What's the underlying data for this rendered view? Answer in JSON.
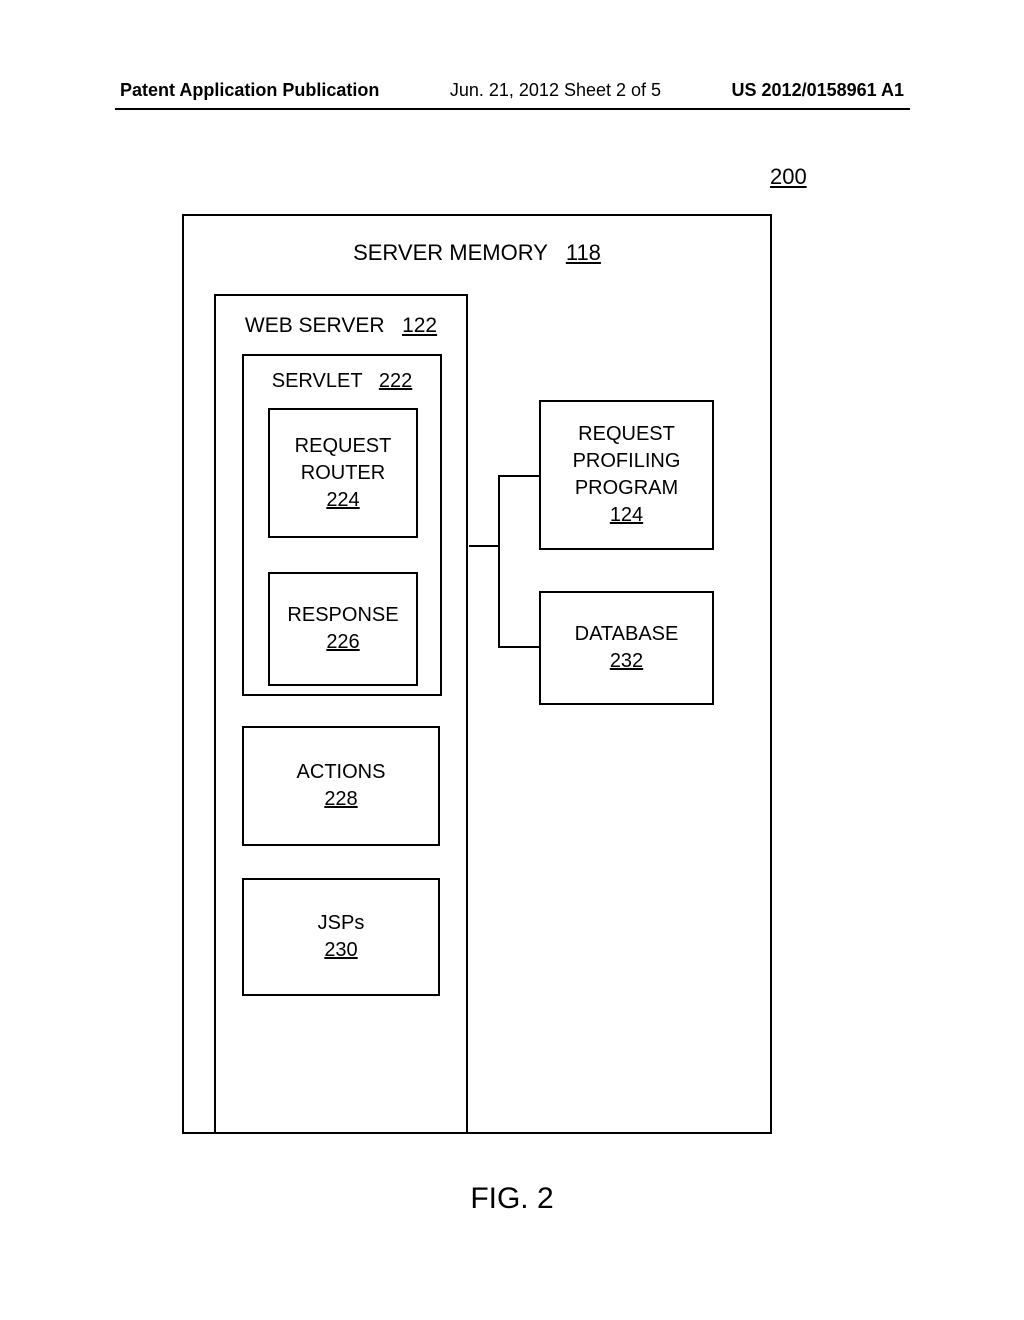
{
  "header": {
    "left": "Patent Application Publication",
    "center": "Jun. 21, 2012  Sheet 2 of 5",
    "right": "US 2012/0158961 A1"
  },
  "figure_number": "200",
  "server_memory": {
    "label": "SERVER MEMORY",
    "num": "118"
  },
  "web_server": {
    "label": "WEB SERVER",
    "num": "122"
  },
  "servlet": {
    "label": "SERVLET",
    "num": "222"
  },
  "request_router": {
    "label1": "REQUEST",
    "label2": "ROUTER",
    "num": "224"
  },
  "response": {
    "label": "RESPONSE",
    "num": "226"
  },
  "actions": {
    "label": "ACTIONS",
    "num": "228"
  },
  "jsps": {
    "label": "JSPs",
    "num": "230"
  },
  "request_profiling": {
    "label1": "REQUEST",
    "label2": "PROFILING",
    "label3": "PROGRAM",
    "num": "124"
  },
  "database": {
    "label": "DATABASE",
    "num": "232"
  },
  "caption": "FIG. 2"
}
